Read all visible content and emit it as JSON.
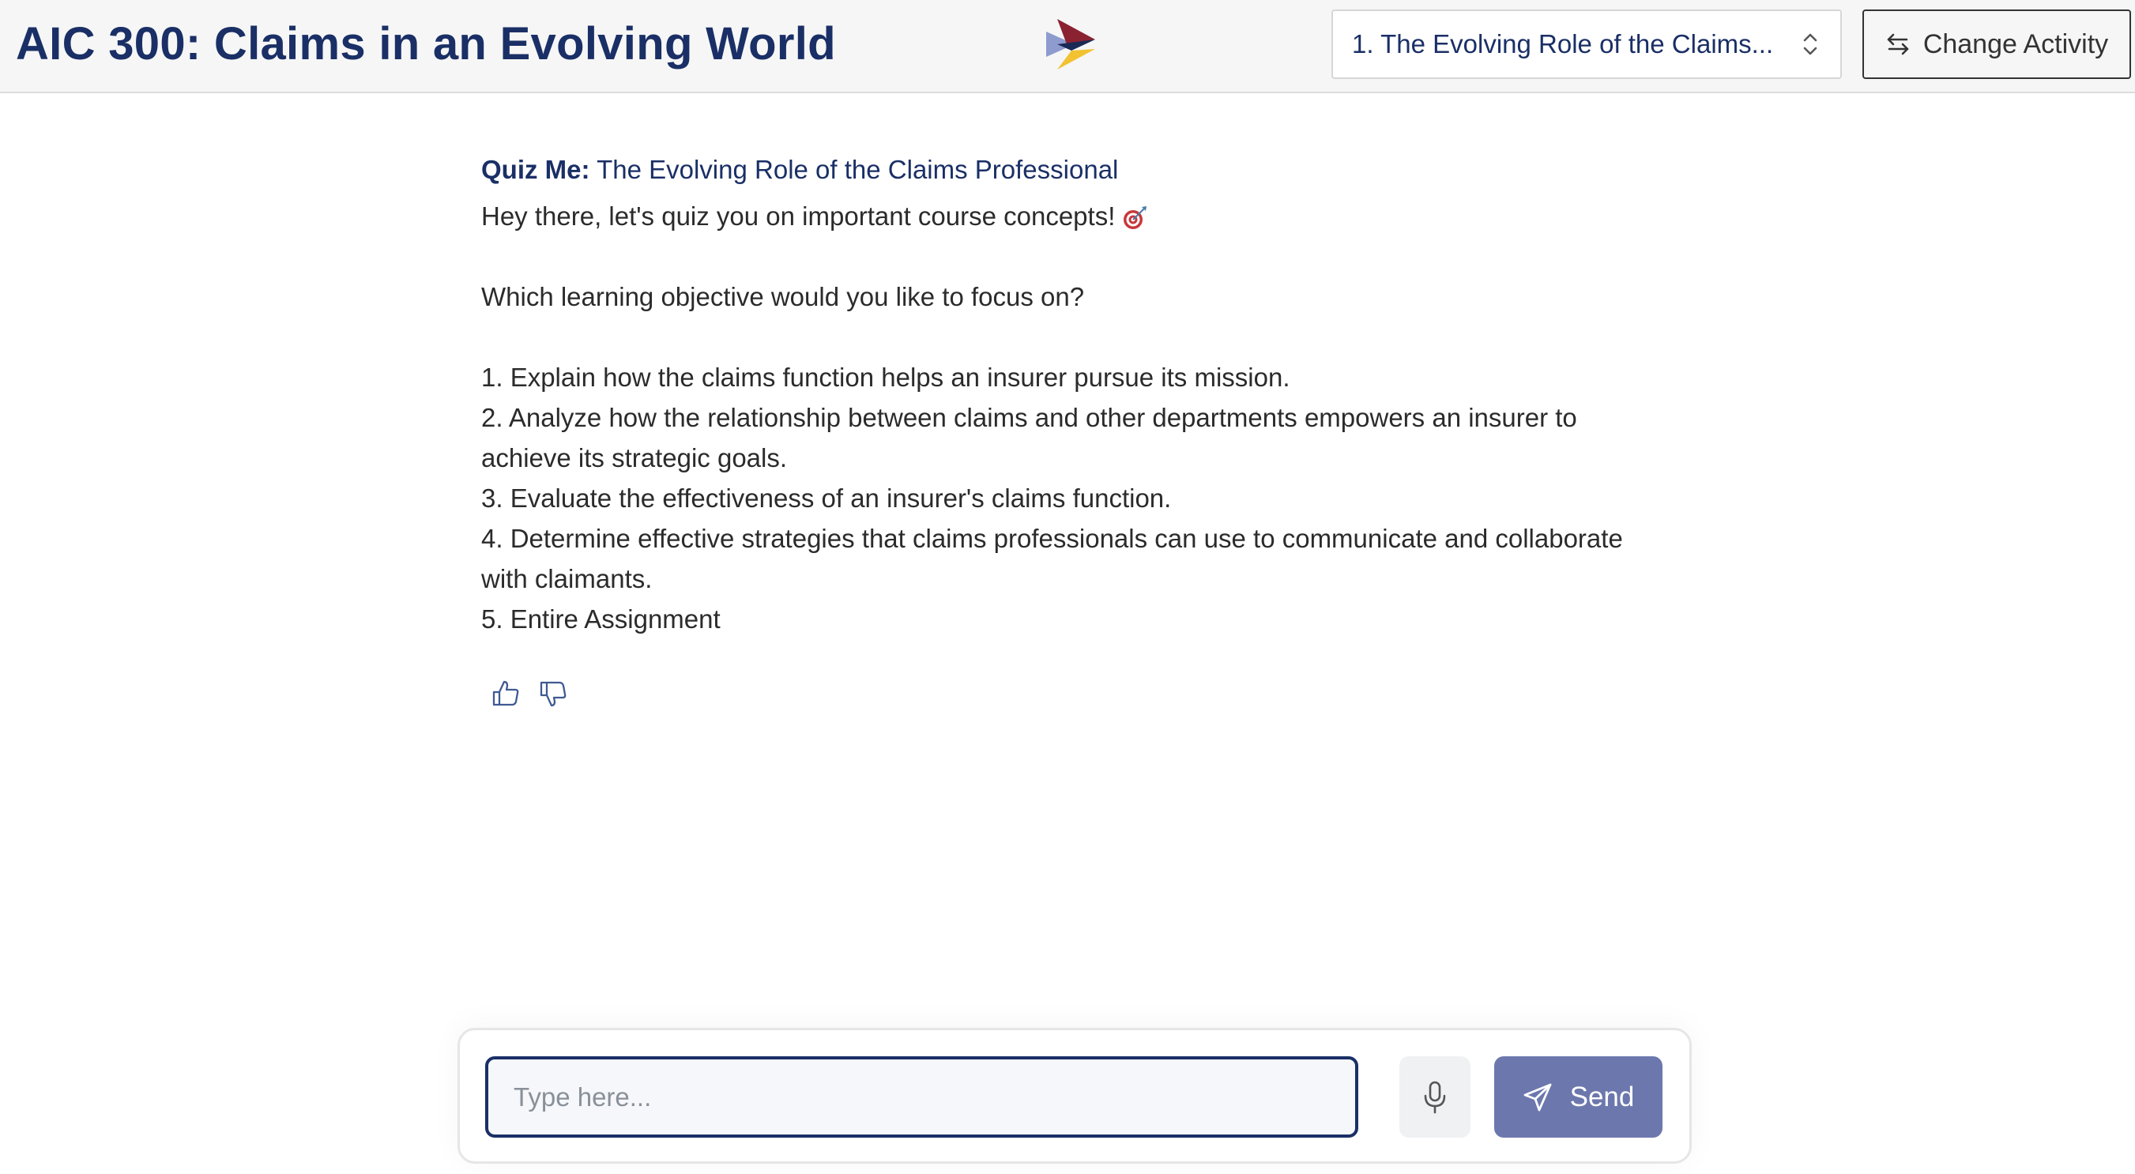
{
  "header": {
    "title": "AIC 300: Claims in an Evolving World",
    "module_select_value": "1. The Evolving Role of the Claims...",
    "change_activity_label": "Change Activity"
  },
  "message": {
    "heading_prefix": "Quiz Me:",
    "heading_title": "The Evolving Role of the Claims Professional",
    "greeting": "Hey there, let's quiz you on important course concepts!",
    "question": "Which learning objective would you like to focus on?",
    "objectives": [
      "1. Explain how the claims function helps an insurer pursue its mission.",
      "2. Analyze how the relationship between claims and other departments empowers an insurer to achieve its strategic goals.",
      "3. Evaluate the effectiveness of an insurer's claims function.",
      "4. Determine effective strategies that claims professionals can use to communicate and collaborate with claimants.",
      "5. Entire Assignment"
    ]
  },
  "composer": {
    "placeholder": "Type here...",
    "send_label": "Send"
  },
  "icons": {
    "logo": "brand-triangle-logo",
    "module_select": "chevron-updown-icon",
    "change_activity": "swap-arrows-icon",
    "greeting": "target-icon",
    "thumbs_up": "thumbs-up-icon",
    "thumbs_down": "thumbs-down-icon",
    "mic": "microphone-icon",
    "send": "paper-plane-icon"
  },
  "colors": {
    "brand_navy": "#1a2f66",
    "send_button": "#6c78ad",
    "header_bg": "#f6f6f6"
  }
}
